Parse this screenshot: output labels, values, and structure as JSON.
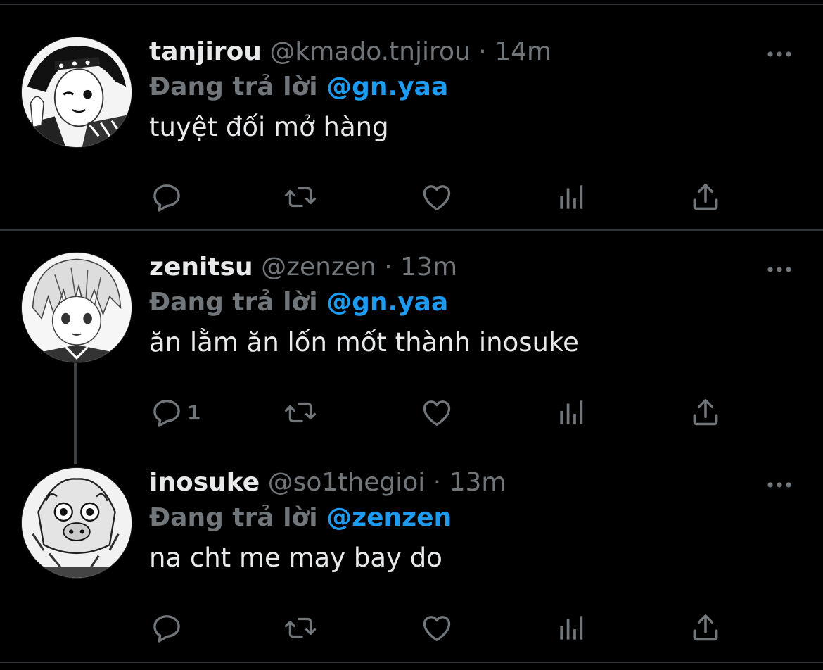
{
  "colors": {
    "background": "#000000",
    "divider": "#2f3336",
    "muted": "#71767b",
    "mention": "#1d9bf0",
    "text": "#e7e9ea"
  },
  "tweets": [
    {
      "name": "tanjirou",
      "handle": "@kmado.tnjirou",
      "separator": "·",
      "time": "14m",
      "reply_prefix": "Đang trả lời",
      "reply_to": "@gn.yaa",
      "text": "tuyệt đối mở hàng",
      "reply_count": "",
      "avatar": "avatar-tanjirou"
    },
    {
      "name": "zenitsu",
      "handle": "@zenzen",
      "separator": "·",
      "time": "13m",
      "reply_prefix": "Đang trả lời",
      "reply_to": "@gn.yaa",
      "text": "ăn lằm ăn lốn mốt thành inosuke",
      "reply_count": "1",
      "avatar": "avatar-zenitsu"
    },
    {
      "name": "inosuke",
      "handle": "@so1thegioi",
      "separator": "·",
      "time": "13m",
      "reply_prefix": "Đang trả lời",
      "reply_to": "@zenzen",
      "text": "na cht me may bay do",
      "reply_count": "",
      "avatar": "avatar-inosuke"
    }
  ],
  "icons": [
    "reply-icon",
    "retweet-icon",
    "like-icon",
    "analytics-icon",
    "share-icon",
    "more-icon"
  ]
}
